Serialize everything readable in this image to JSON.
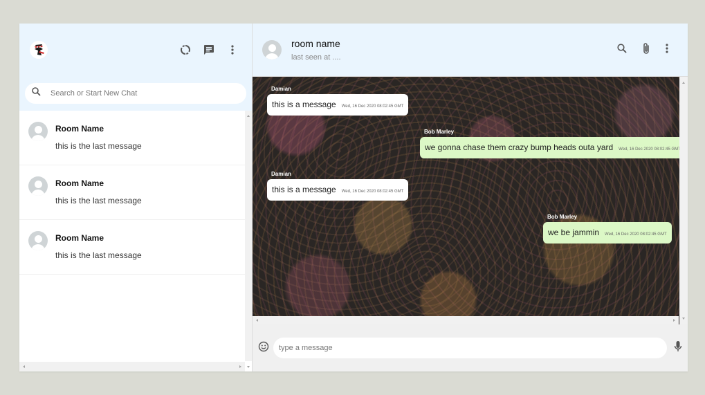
{
  "sidebar": {
    "icons": [
      "logo-icon",
      "status-icon",
      "chat-icon",
      "more-vert-icon"
    ],
    "search": {
      "placeholder": "Search or Start New Chat"
    },
    "chats": [
      {
        "name": "Room Name",
        "last_message": "this is the last message"
      },
      {
        "name": "Room Name",
        "last_message": "this is the last message"
      },
      {
        "name": "Room Name",
        "last_message": "this is the last message"
      }
    ]
  },
  "chat": {
    "header": {
      "room_name": "room name",
      "last_seen": "last seen at ...."
    },
    "header_icons": [
      "search-icon",
      "attach-icon",
      "more-vert-icon"
    ],
    "messages": [
      {
        "sender": "Damian",
        "text": "this is a message",
        "timestamp": "Wed, 16 Dec 2020 08:02:45 GMT",
        "sent": false
      },
      {
        "sender": "Bob Marley",
        "text": "we gonna chase them crazy bump heads outa yard",
        "timestamp": "Wed, 16 Dec 2020 08:02:45 GMT",
        "sent": true
      },
      {
        "sender": "Damian",
        "text": "this is a message",
        "timestamp": "Wed, 16 Dec 2020 08:02:45 GMT",
        "sent": false
      },
      {
        "sender": "Bob Marley",
        "text": "we be jammin",
        "timestamp": "Wed, 16 Dec 2020 08:02:45 GMT",
        "sent": true
      }
    ],
    "footer": {
      "input_placeholder": "type a message",
      "icons": [
        "emoji-icon",
        "mic-icon"
      ]
    }
  },
  "colors": {
    "header_bg": "#eaf5fe",
    "sent_bubble": "#dcf8c6",
    "received_bubble": "#ffffff",
    "page_bg": "#dadbd3"
  }
}
